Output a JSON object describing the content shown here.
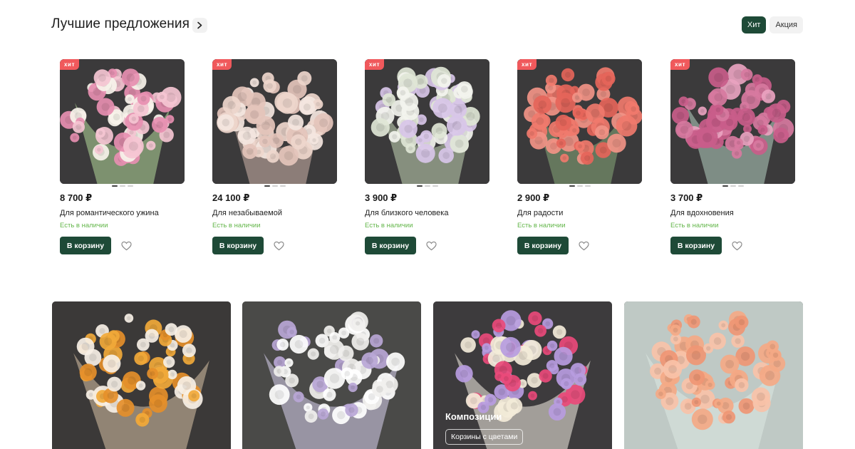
{
  "section": {
    "title": "Лучшие предложения"
  },
  "filters": [
    {
      "label": "Хит",
      "active": true
    },
    {
      "label": "Акция",
      "active": false
    }
  ],
  "products": [
    {
      "badge": "хит",
      "price": "8 700 ₽",
      "name": "Для романтического ужина",
      "stock": "Есть в наличии",
      "cart_label": "В корзину",
      "palette": [
        "#f5c6d2",
        "#e78fb1",
        "#f7f3ea",
        "#b5d89a"
      ]
    },
    {
      "badge": "хит",
      "price": "24 100 ₽",
      "name": "Для незабываемой",
      "stock": "Есть в наличии",
      "cart_label": "В корзину",
      "palette": [
        "#eed6cc",
        "#e4c4bb",
        "#f4e6df",
        "#cfb4ab"
      ]
    },
    {
      "badge": "хит",
      "price": "3 900 ₽",
      "name": "Для близкого человека",
      "stock": "Есть в наличии",
      "cart_label": "В корзину",
      "palette": [
        "#f3f4ee",
        "#dfe6d6",
        "#d8c6e8",
        "#c4d6b6"
      ]
    },
    {
      "badge": "хит",
      "price": "2 900 ₽",
      "name": "Для радости",
      "stock": "Есть в наличии",
      "cart_label": "В корзину",
      "palette": [
        "#f07a6c",
        "#e5655a",
        "#f29487",
        "#89a97a"
      ]
    },
    {
      "badge": "хит",
      "price": "3 700 ₽",
      "name": "Для вдохновения",
      "stock": "Есть в наличии",
      "cart_label": "В корзину",
      "palette": [
        "#d77aa0",
        "#c95d8a",
        "#e9a3c0",
        "#b6d1c2"
      ]
    }
  ],
  "categories": [
    {
      "title": "",
      "chip": "",
      "bg": "#3b3938",
      "palette": [
        "#f1a93a",
        "#e58f2a",
        "#f7f0e6",
        "#d9c3a5"
      ]
    },
    {
      "title": "",
      "chip": "",
      "bg": "#4a4a48",
      "palette": [
        "#ffffff",
        "#f1f0ee",
        "#b9a6d6",
        "#d9d2ee"
      ]
    },
    {
      "title": "Композиции",
      "chip": "Корзины с цветами",
      "bg": "#3d3b3d",
      "palette": [
        "#f3ecd9",
        "#e94a79",
        "#b79ce0",
        "#f5f1e6"
      ]
    },
    {
      "title": "",
      "chip": "",
      "bg": "#bfc9c5",
      "palette": [
        "#f4a986",
        "#ef9674",
        "#f8c2a8",
        "#dde8e2"
      ]
    }
  ],
  "icons": {
    "title_arrow": "chevron-right-icon",
    "favorite": "heart-icon"
  },
  "colors": {
    "brand_green": "#1e4a37",
    "hit_badge": "#f0595c",
    "stock_green": "#63b64a"
  }
}
